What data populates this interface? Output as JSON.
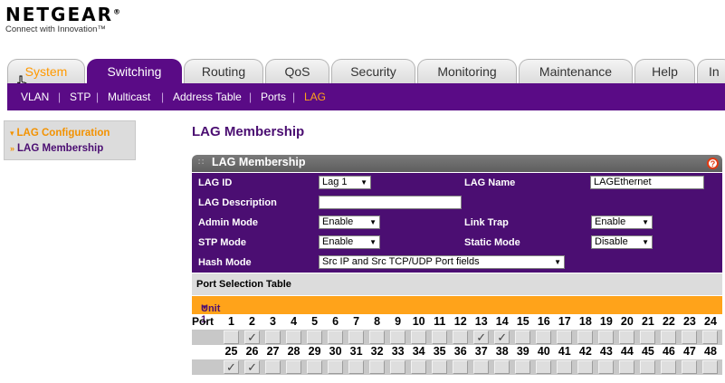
{
  "brand": {
    "name": "NETGEAR",
    "reg": "®",
    "tagline": "Connect with Innovation™"
  },
  "tabs": [
    {
      "label": "System",
      "active": false
    },
    {
      "label": "Switching",
      "active": true
    },
    {
      "label": "Routing",
      "active": false
    },
    {
      "label": "QoS",
      "active": false
    },
    {
      "label": "Security",
      "active": false
    },
    {
      "label": "Monitoring",
      "active": false
    },
    {
      "label": "Maintenance",
      "active": false
    },
    {
      "label": "Help",
      "active": false
    },
    {
      "label": "In",
      "active": false
    }
  ],
  "subnav": [
    "VLAN",
    "STP",
    "Multicast",
    "Address Table",
    "Ports",
    "LAG"
  ],
  "subnav_active": "LAG",
  "leftmenu": [
    {
      "label": "LAG Configuration",
      "active": false
    },
    {
      "label": "LAG Membership",
      "active": true
    }
  ],
  "page_title": "LAG Membership",
  "panel": {
    "title": "LAG Membership",
    "help": "?",
    "lag_id_label": "LAG ID",
    "lag_id": "Lag 1",
    "lag_name_label": "LAG Name",
    "lag_name": "LAGEthernet",
    "lag_desc_label": "LAG Description",
    "lag_desc": "",
    "admin_mode_label": "Admin Mode",
    "admin_mode": "Enable",
    "link_trap_label": "Link Trap",
    "link_trap": "Enable",
    "stp_mode_label": "STP Mode",
    "stp_mode": "Enable",
    "static_mode_label": "Static Mode",
    "static_mode": "Disable",
    "hash_mode_label": "Hash Mode",
    "hash_mode": "Src IP and Src TCP/UDP Port fields",
    "port_table_title": "Port Selection Table",
    "unit_label": "Unit 1",
    "port_label": "Port"
  },
  "ports_row1": [
    "1",
    "2",
    "3",
    "4",
    "5",
    "6",
    "7",
    "8",
    "9",
    "10",
    "11",
    "12",
    "13",
    "14",
    "15",
    "16",
    "17",
    "18",
    "19",
    "20",
    "21",
    "22",
    "23",
    "24"
  ],
  "ports_row2": [
    "25",
    "26",
    "27",
    "28",
    "29",
    "30",
    "31",
    "32",
    "33",
    "34",
    "35",
    "36",
    "37",
    "38",
    "39",
    "40",
    "41",
    "42",
    "43",
    "44",
    "45",
    "46",
    "47",
    "48"
  ],
  "checked_row1": [
    false,
    true,
    false,
    false,
    false,
    false,
    false,
    false,
    false,
    false,
    false,
    false,
    true,
    true,
    false,
    false,
    false,
    false,
    false,
    false,
    false,
    false,
    false,
    false
  ],
  "checked_row2": [
    true,
    true,
    false,
    false,
    false,
    false,
    false,
    false,
    false,
    false,
    false,
    false,
    false,
    false,
    false,
    false,
    false,
    false,
    false,
    false,
    false,
    false,
    false,
    false
  ],
  "check_glyph": "✓"
}
